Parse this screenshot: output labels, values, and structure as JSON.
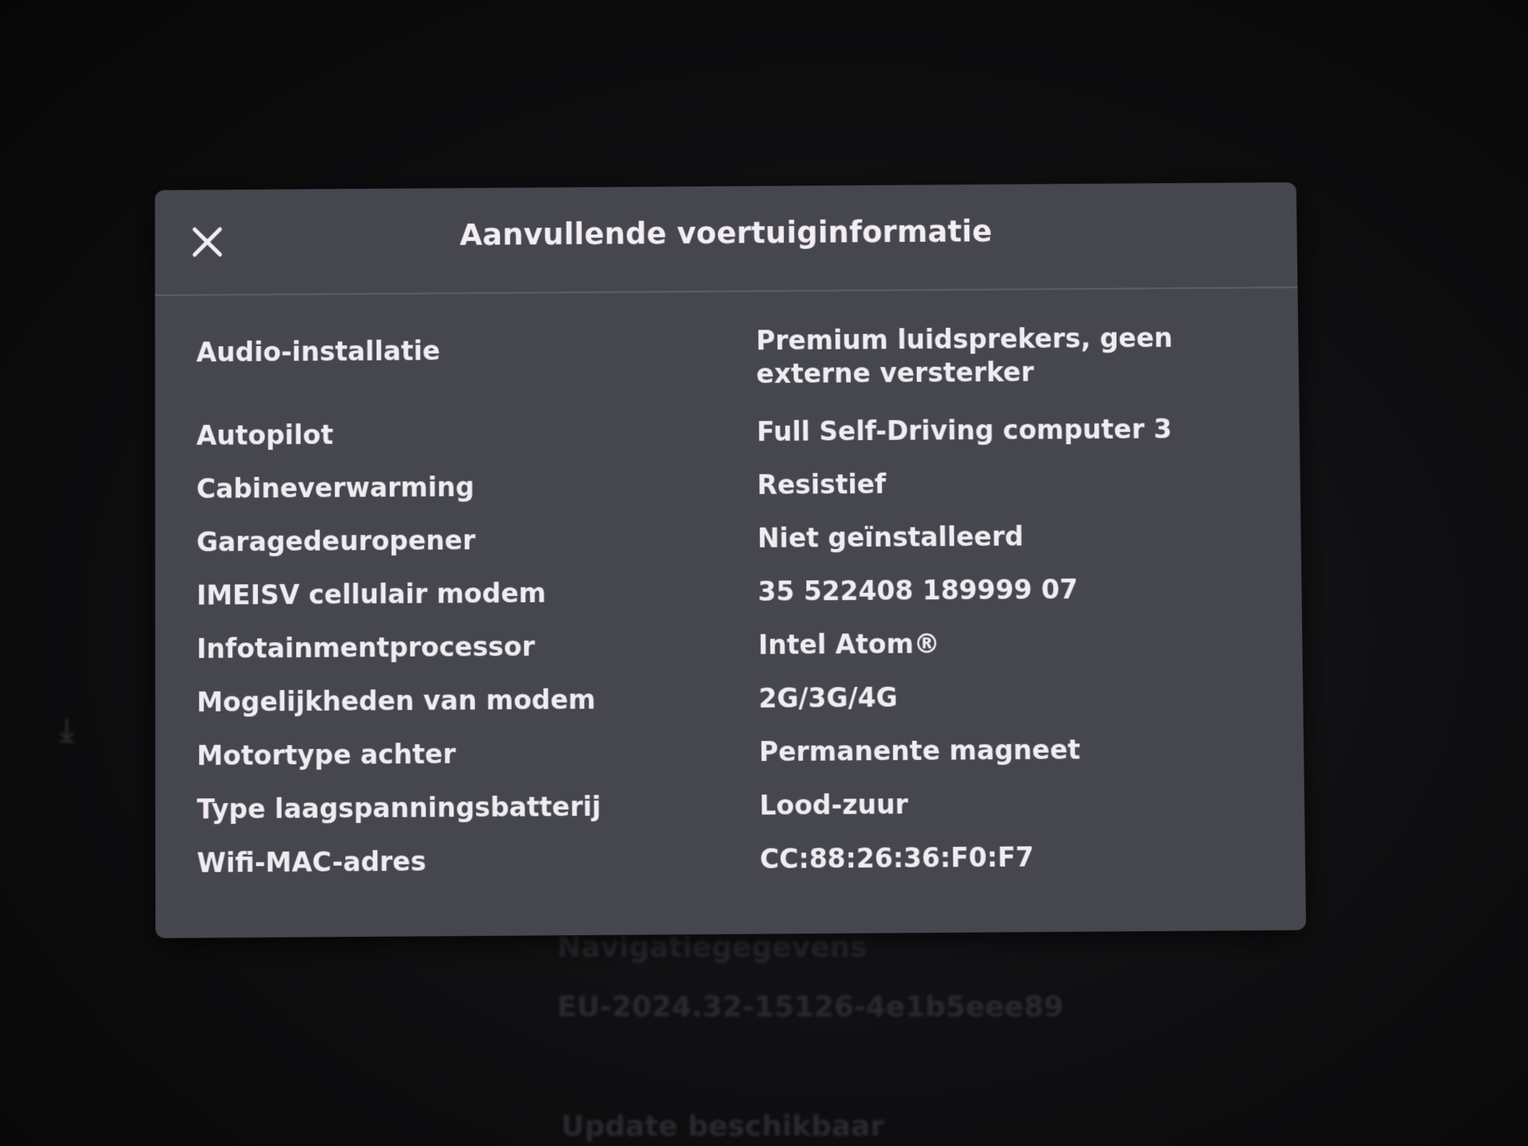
{
  "background": {
    "nav_label": "Navigatiegegevens",
    "nav_value": "EU-2024.32-15126-4e1b5eee89",
    "update_text": "Update beschikbaar"
  },
  "modal": {
    "title": "Aanvullende voertuiginformatie",
    "close_icon": "close-icon",
    "rows": [
      {
        "label": "Audio-installatie",
        "value": "Premium luidsprekers, geen externe versterker"
      },
      {
        "label": "Autopilot",
        "value": "Full Self-Driving computer 3"
      },
      {
        "label": "Cabineverwarming",
        "value": "Resistief"
      },
      {
        "label": "Garagedeuropener",
        "value": "Niet geïnstalleerd"
      },
      {
        "label": "IMEISV cellulair modem",
        "value": "35 522408 189999 07"
      },
      {
        "label": "Infotainmentprocessor",
        "value": "Intel Atom®"
      },
      {
        "label": "Mogelijkheden van modem",
        "value": "2G/3G/4G"
      },
      {
        "label": "Motortype achter",
        "value": "Permanente magneet"
      },
      {
        "label": "Type laagspanningsbatterij",
        "value": "Lood-zuur"
      },
      {
        "label": "Wifi-MAC-adres",
        "value": "CC:88:26:36:F0:F7"
      }
    ]
  },
  "colors": {
    "modal_background": "#45464e",
    "text": "#f1ecf2",
    "divider": "#5d5e66"
  }
}
